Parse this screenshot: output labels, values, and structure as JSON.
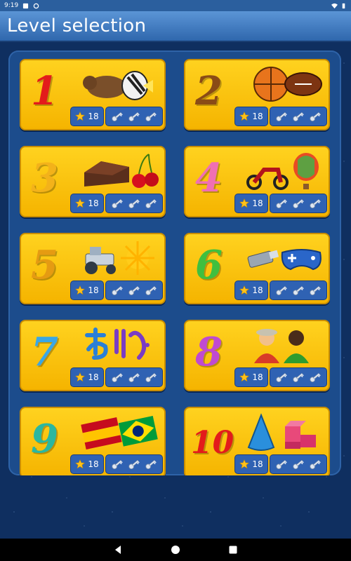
{
  "status_bar": {
    "time": "9:19"
  },
  "app_bar": {
    "title": "Level selection"
  },
  "levels": [
    {
      "number": "1",
      "stars": "18",
      "color": "#e31b1b",
      "art": "bear-and-fish"
    },
    {
      "number": "2",
      "stars": "18",
      "color": "#8a4b16",
      "art": "basketball-and-football"
    },
    {
      "number": "3",
      "stars": "18",
      "color": "#f3b21a",
      "art": "cake-and-cherries"
    },
    {
      "number": "4",
      "stars": "18",
      "color": "#f06fb4",
      "art": "motorcycle-and-balloon"
    },
    {
      "number": "5",
      "stars": "18",
      "color": "#e59b12",
      "art": "tractor-and-sun"
    },
    {
      "number": "6",
      "stars": "18",
      "color": "#3fbf3f",
      "art": "usb-and-gamepad"
    },
    {
      "number": "7",
      "stars": "18",
      "color": "#3aa7e6",
      "art": "japanese-letters"
    },
    {
      "number": "8",
      "stars": "18",
      "color": "#c04ad1",
      "art": "two-people"
    },
    {
      "number": "9",
      "stars": "18",
      "color": "#2bb7a0",
      "art": "spain-and-brazil-flags"
    },
    {
      "number": "10",
      "stars": "18",
      "color": "#e31b1b",
      "art": "cone-and-blocks"
    }
  ],
  "icons": {
    "star": "star-icon",
    "key": "key-icon",
    "back": "back-icon",
    "home": "home-icon",
    "recents": "recents-icon"
  }
}
